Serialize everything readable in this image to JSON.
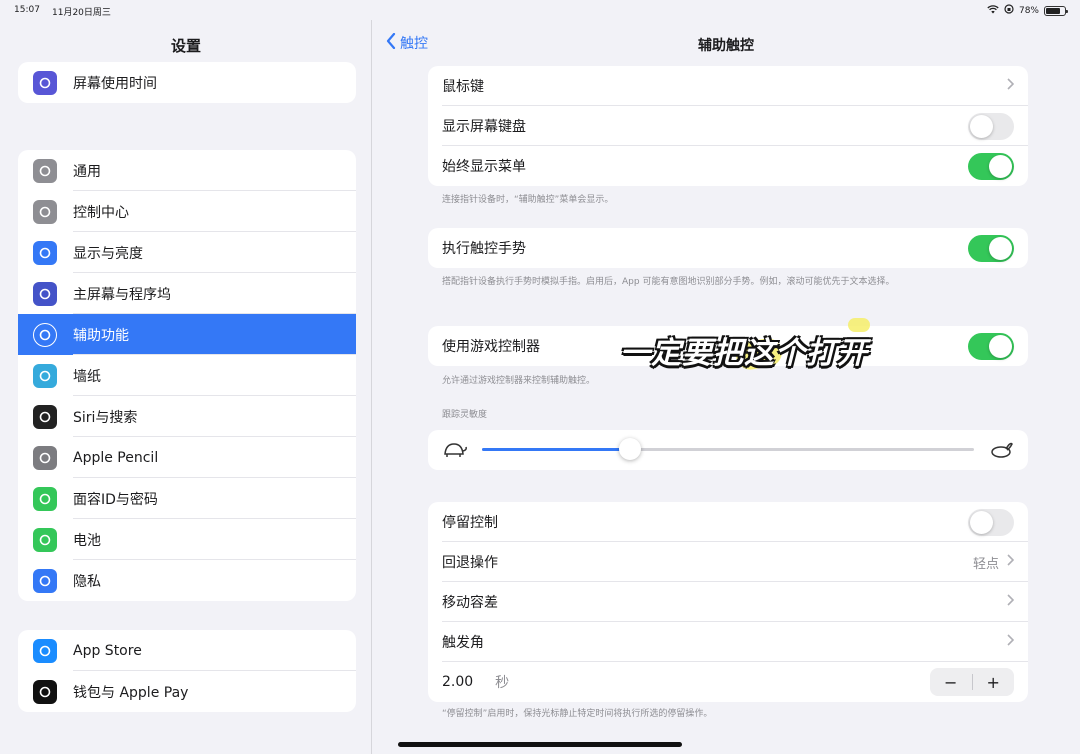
{
  "status": {
    "time": "15:07",
    "date": "11月20日周三",
    "battery": "78%",
    "battery_level": 0.78
  },
  "sidebar": {
    "title": "设置",
    "groups": [
      [
        {
          "label": "屏幕使用时间",
          "icon": "hourglass-icon",
          "color": "#5856d6"
        }
      ],
      [
        {
          "label": "通用",
          "icon": "gear-icon",
          "color": "#8e8e93"
        },
        {
          "label": "控制中心",
          "icon": "control-center-icon",
          "color": "#8e8e93"
        },
        {
          "label": "显示与亮度",
          "icon": "display-brightness-icon",
          "color": "#3478f6"
        },
        {
          "label": "主屏幕与程序坞",
          "icon": "home-screen-icon",
          "color": "#4453c8"
        },
        {
          "label": "辅助功能",
          "icon": "accessibility-icon",
          "color": "#3478f6",
          "active": true
        },
        {
          "label": "墙纸",
          "icon": "wallpaper-icon",
          "color": "#35aadc"
        },
        {
          "label": "Siri与搜索",
          "icon": "siri-icon",
          "color": "#222"
        },
        {
          "label": "Apple Pencil",
          "icon": "pencil-icon",
          "color": "#7c7c80"
        },
        {
          "label": "面容ID与密码",
          "icon": "faceid-icon",
          "color": "#34c759"
        },
        {
          "label": "电池",
          "icon": "battery-icon",
          "color": "#34c759"
        },
        {
          "label": "隐私",
          "icon": "hand-icon",
          "color": "#3478f6"
        }
      ],
      [
        {
          "label": "App Store",
          "icon": "app-store-icon",
          "color": "#1a8cff"
        },
        {
          "label": "钱包与 Apple Pay",
          "icon": "wallet-icon",
          "color": "#111"
        }
      ]
    ]
  },
  "detail": {
    "back_label": "触控",
    "title": "辅助触控",
    "card1": [
      {
        "label": "鼠标键",
        "type": "chevron"
      },
      {
        "label": "显示屏幕键盘",
        "type": "toggle",
        "on": false
      },
      {
        "label": "始终显示菜单",
        "type": "toggle",
        "on": true
      }
    ],
    "foot1": "连接指针设备时，“辅助触控”菜单会显示。",
    "card2": [
      {
        "label": "执行触控手势",
        "type": "toggle",
        "on": true
      }
    ],
    "foot2": "搭配指针设备执行手势时模拟手指。启用后，App 可能有意图地识别部分手势。例如，滚动可能优先于文本选择。",
    "card3": [
      {
        "label": "使用游戏控制器",
        "type": "toggle",
        "on": true
      }
    ],
    "foot3": "允许通过游戏控制器来控制辅助触控。",
    "tracking_header": "跟踪灵敏度",
    "tracking_value": 0.3,
    "card4": [
      {
        "label": "停留控制",
        "type": "toggle",
        "on": false
      },
      {
        "label": "回退操作",
        "type": "value",
        "value": "轻点"
      },
      {
        "label": "移动容差",
        "type": "chevron"
      },
      {
        "label": "触发角",
        "type": "chevron"
      }
    ],
    "dwell_time": "2.00",
    "dwell_unit": "秒",
    "stepper_minus": "−",
    "stepper_plus": "+",
    "foot4": "“停留控制”启用时，保持光标静止特定时间将执行所选的停留操作。"
  },
  "overlay_caption": "一定要把这个打开"
}
